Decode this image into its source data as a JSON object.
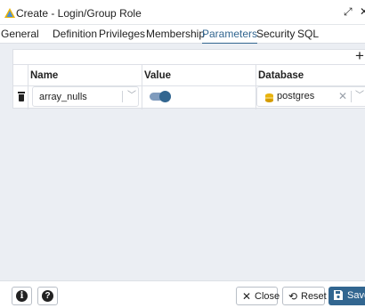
{
  "window": {
    "title": "Create - Login/Group Role"
  },
  "tabs": [
    {
      "label": "General"
    },
    {
      "label": "Definition"
    },
    {
      "label": "Privileges"
    },
    {
      "label": "Membership"
    },
    {
      "label": "Parameters",
      "active": true
    },
    {
      "label": "Security"
    },
    {
      "label": "SQL"
    }
  ],
  "grid": {
    "add_label": "+",
    "columns": [
      "Name",
      "Value",
      "Database"
    ],
    "rows": [
      {
        "name": "array_nulls",
        "value_on": true,
        "database": "postgres"
      }
    ]
  },
  "footer": {
    "info_icon": "i",
    "help_icon": "?",
    "close_label": "Close",
    "reset_label": "Reset",
    "save_label": "Save"
  },
  "colors": {
    "accent": "#326690",
    "content_bg": "#ebeef3",
    "database_icon": "#e8b30d"
  },
  "icons": {
    "app": "pgadmin-triangle-icon",
    "expand": "expand-arrows-icon",
    "close": "close-icon",
    "add": "plus-icon",
    "delete": "trash-icon",
    "chevron": "chevron-down-icon",
    "database": "database-icon",
    "clear": "clear-x-icon",
    "info": "info-circle-icon",
    "help": "question-circle-icon",
    "close_btn": "x-icon",
    "reset": "history-icon",
    "save": "floppy-disk-icon"
  }
}
